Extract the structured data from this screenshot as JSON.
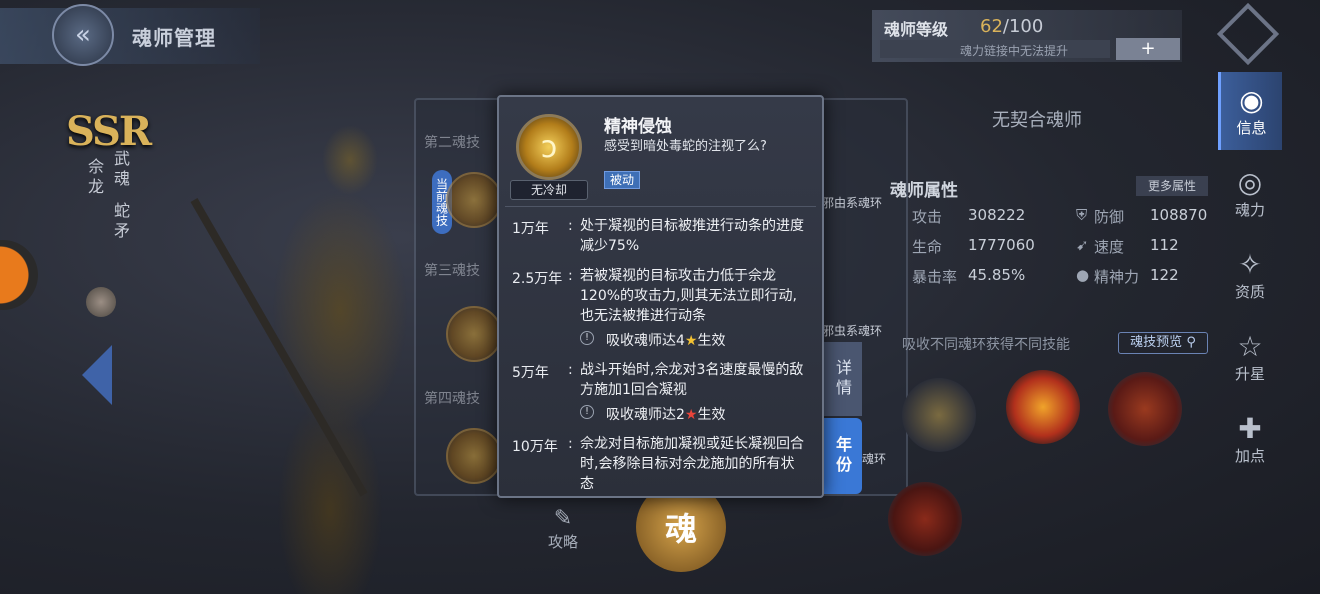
{
  "header": {
    "title": "魂师管理",
    "back_icon": "back-arrow-icon"
  },
  "left_panel": {
    "rarity": "SSR",
    "hero_name": "佘龙",
    "martial_soul_label": "武魂",
    "martial_soul_name": "蛇矛"
  },
  "skill_list": {
    "labels": [
      "第二魂技",
      "第三魂技",
      "第四魂技"
    ],
    "current_tag": "当前魂技",
    "ring_type_texts": [
      "邪由系魂环",
      "邪虫系魂环",
      "魂环"
    ],
    "detail_button": "详情",
    "year_button": "年份"
  },
  "right_panel": {
    "level_label": "魂师等级",
    "level_value": "62",
    "level_max": "/100",
    "level_hint": "魂力链接中无法提升",
    "plus_label": "+",
    "no_contract": "无契合魂师",
    "attributes_title": "魂师属性",
    "more_attributes": "更多属性",
    "stats": [
      {
        "name": "攻击",
        "value": "308222",
        "icon": "sword-icon"
      },
      {
        "name": "防御",
        "value": "108870",
        "icon": "shield-icon"
      },
      {
        "name": "生命",
        "value": "1777060",
        "icon": "heart-icon"
      },
      {
        "name": "速度",
        "value": "112",
        "icon": "boot-icon"
      },
      {
        "name": "暴击率",
        "value": "45.85%",
        "icon": "crit-icon"
      },
      {
        "name": "精神力",
        "value": "122",
        "icon": "brain-icon"
      }
    ],
    "receive_hint": "吸收不同魂环获得不同技能",
    "preview_button": "魂技预览"
  },
  "sidebar": [
    {
      "label": "信息",
      "icon": "info-icon",
      "active": true
    },
    {
      "label": "魂力",
      "icon": "soul-power-icon",
      "active": false
    },
    {
      "label": "资质",
      "icon": "aptitude-icon",
      "active": false
    },
    {
      "label": "升星",
      "icon": "star-icon",
      "active": false
    },
    {
      "label": "加点",
      "icon": "add-point-icon",
      "active": false
    }
  ],
  "bottom": {
    "guide_label": "攻略",
    "wuhun_label": "魂"
  },
  "tooltip": {
    "skill_name": "精神侵蚀",
    "skill_desc": "感受到暗处毒蛇的注视了么?",
    "cooldown": "无冷却",
    "type_tag": "被动",
    "rows": [
      {
        "year": "1万年",
        "colon": ":",
        "text": "处于凝视的目标被推进行动条的进度减少75%",
        "note": ""
      },
      {
        "year": "2.5万年",
        "colon": ":",
        "text": "若被凝视的目标攻击力低于佘龙120%的攻击力,则其无法立即行动,也无法被推进行动条",
        "note_prefix": "吸收魂师达4",
        "note_suffix": "生效",
        "star": "gold"
      },
      {
        "year": "5万年",
        "colon": ":",
        "text": "战斗开始时,佘龙对3名速度最慢的敌方施加1回合凝视",
        "note_prefix": "吸收魂师达2",
        "note_suffix": "生效",
        "star": "red"
      },
      {
        "year": "10万年",
        "colon": ":",
        "text": "佘龙对目标施加凝视或延长凝视回合时,会移除目标对佘龙施加的所有状态",
        "note": ""
      }
    ]
  }
}
